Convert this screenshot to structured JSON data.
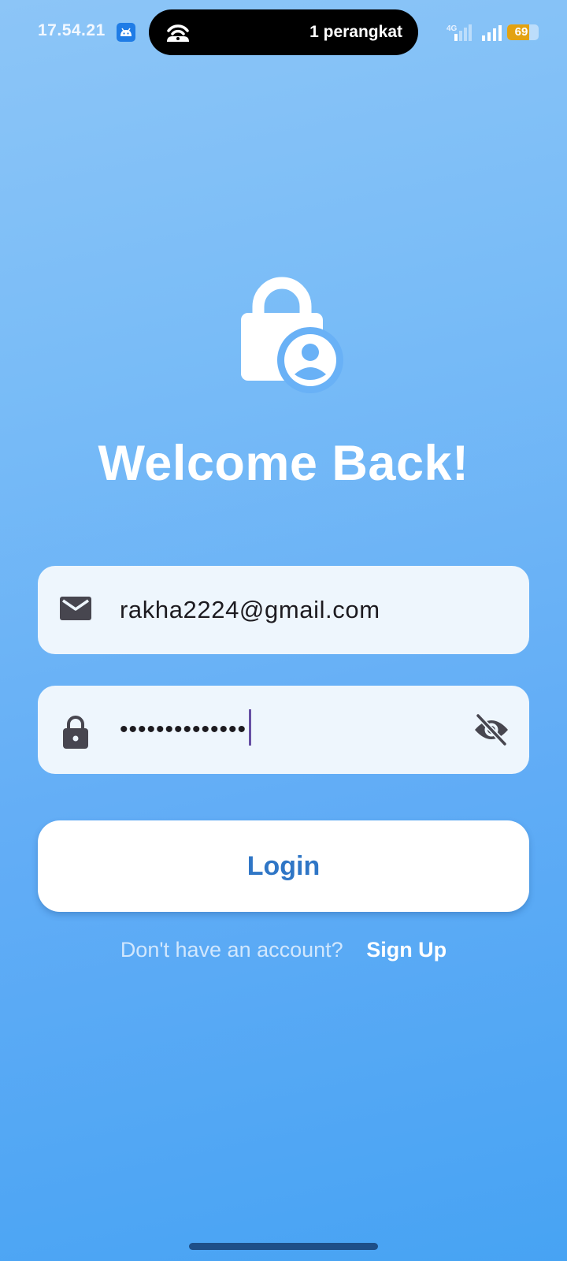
{
  "status_bar": {
    "time": "17.54.21",
    "hotspot_text": "1 perangkat",
    "network_type": "4G",
    "battery_level": "69",
    "icons": [
      "android-app-icon",
      "hotspot-icon",
      "signal-4g-icon",
      "signal-icon",
      "battery-icon"
    ],
    "battery_color": "#e3a211"
  },
  "login": {
    "title": "Welcome Back!",
    "email_value": "rakha2224@gmail.com",
    "password_masked": "••••••••••••••",
    "login_label": "Login",
    "signup_prompt": "Don't have an account?",
    "signup_link": "Sign Up",
    "icons": [
      "lock-user-icon",
      "email-icon",
      "lock-icon",
      "visibility-off-icon"
    ]
  },
  "colors": {
    "background_top": "#8cc5f7",
    "background_bottom": "#47a3f3",
    "field_background": "#eef6fd",
    "button_text": "#2f76c6",
    "cursor": "#6750a4"
  }
}
